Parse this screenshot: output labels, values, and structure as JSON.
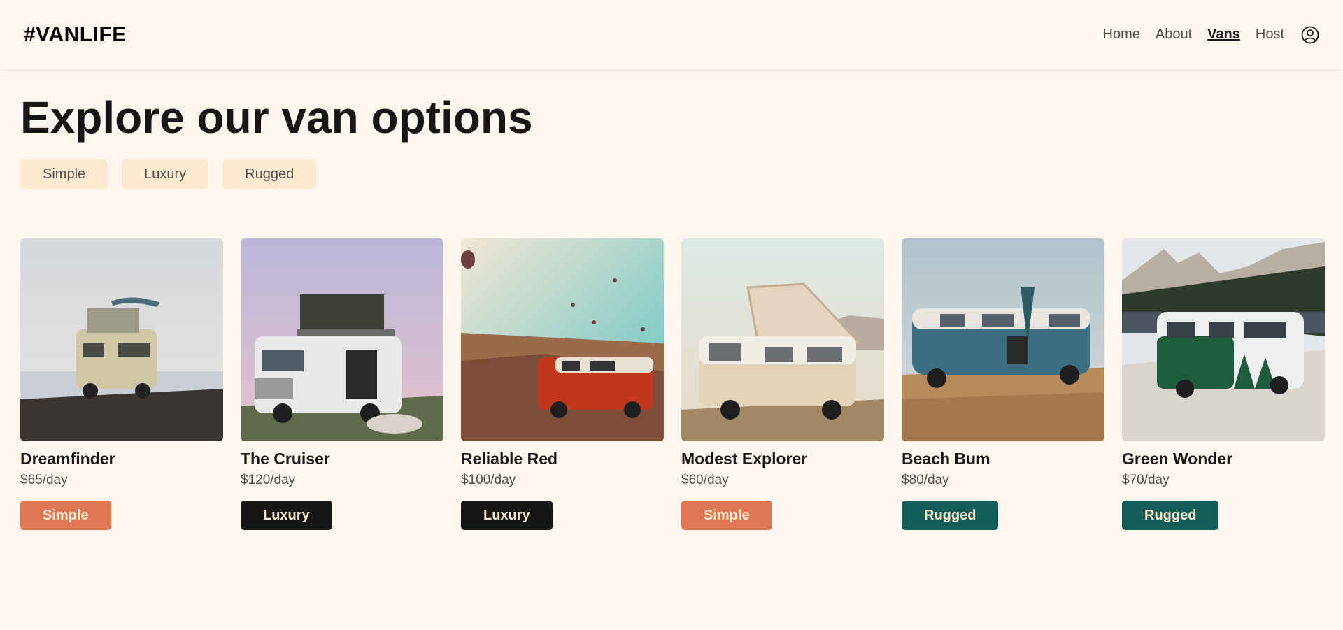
{
  "header": {
    "logo": "#VANLIFE",
    "nav": [
      {
        "label": "Home",
        "active": false
      },
      {
        "label": "About",
        "active": false
      },
      {
        "label": "Vans",
        "active": true
      },
      {
        "label": "Host",
        "active": false
      }
    ],
    "avatar_icon": "user-circle-icon"
  },
  "page": {
    "title": "Explore our van options",
    "filters": [
      "Simple",
      "Luxury",
      "Rugged"
    ]
  },
  "vans": [
    {
      "name": "Dreamfinder",
      "price": "$65/day",
      "type": "Simple",
      "color": "#E17654"
    },
    {
      "name": "The Cruiser",
      "price": "$120/day",
      "type": "Luxury",
      "color": "#161616"
    },
    {
      "name": "Reliable Red",
      "price": "$100/day",
      "type": "Luxury",
      "color": "#161616"
    },
    {
      "name": "Modest Explorer",
      "price": "$60/day",
      "type": "Simple",
      "color": "#E17654"
    },
    {
      "name": "Beach Bum",
      "price": "$80/day",
      "type": "Rugged",
      "color": "#115E59"
    },
    {
      "name": "Green Wonder",
      "price": "$70/day",
      "type": "Rugged",
      "color": "#115E59"
    }
  ],
  "colors": {
    "background": "#FFF7ED",
    "filter_bg": "#FFEAD0",
    "simple": "#E17654",
    "luxury": "#161616",
    "rugged": "#115E59"
  }
}
